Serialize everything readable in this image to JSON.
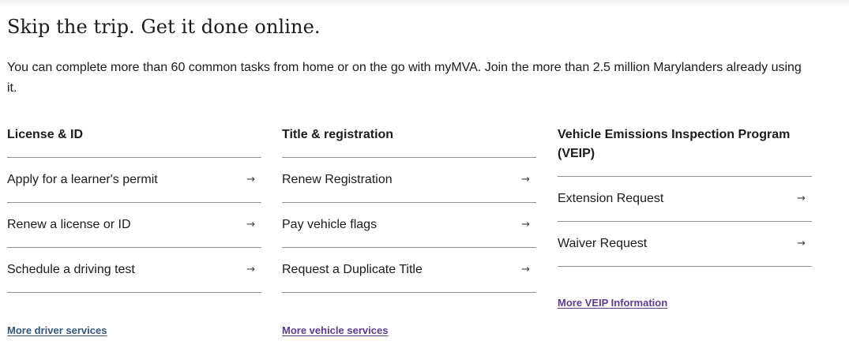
{
  "heading": "Skip the trip. Get it done online.",
  "intro": "You can complete more than 60 common tasks from home or on the go with myMVA. Join the more than 2.5 million Marylanders already using it.",
  "arrow_icon": "→",
  "columns": [
    {
      "title": "License & ID",
      "items": [
        {
          "label": "Apply for a learner's permit"
        },
        {
          "label": "Renew a license or ID"
        },
        {
          "label": "Schedule a driving test"
        }
      ],
      "more_link": {
        "label": "More driver services",
        "color": "#33577a"
      }
    },
    {
      "title": "Title & registration",
      "items": [
        {
          "label": "Renew Registration"
        },
        {
          "label": "Pay vehicle flags"
        },
        {
          "label": "Request a Duplicate Title"
        }
      ],
      "more_link": {
        "label": "More vehicle services",
        "color": "#5c3b8c"
      }
    },
    {
      "title": "Vehicle Emissions Inspection Program (VEIP)",
      "items": [
        {
          "label": "Extension Request"
        },
        {
          "label": "Waiver Request"
        }
      ],
      "more_link": {
        "label": "More VEIP Information",
        "color": "#5c3b8c"
      }
    }
  ]
}
